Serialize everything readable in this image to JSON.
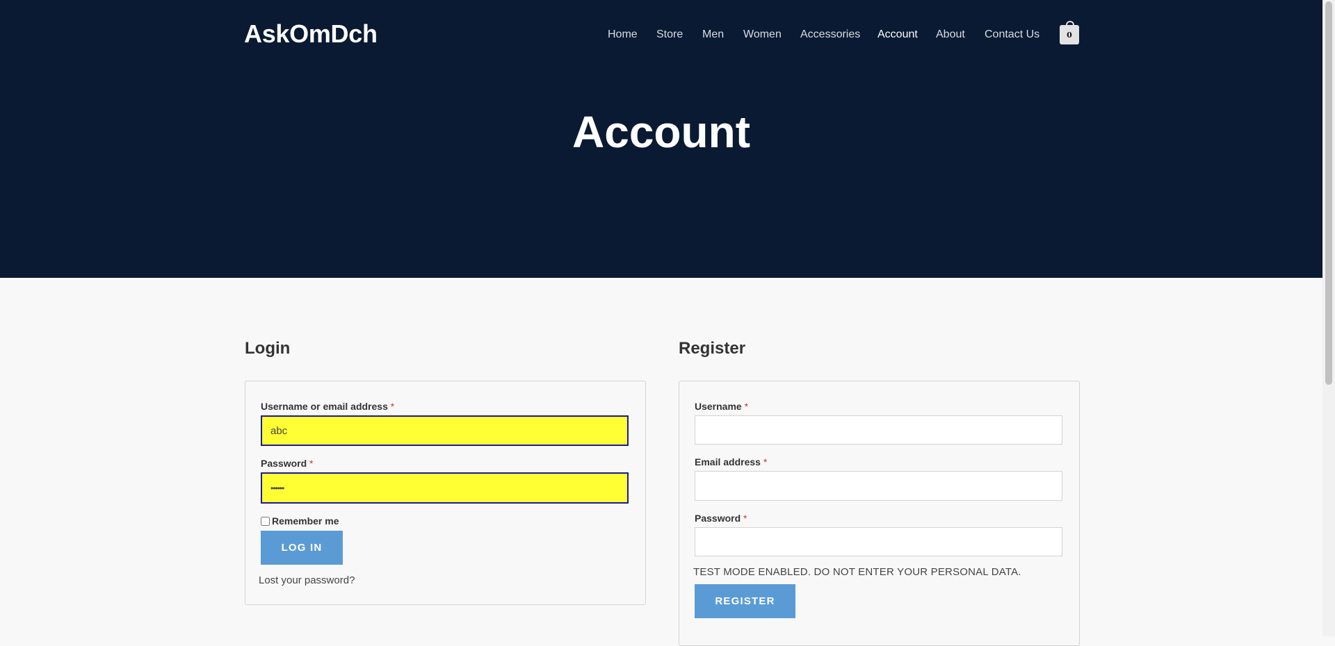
{
  "site": {
    "logo": "AskOmDch"
  },
  "nav": {
    "items": [
      {
        "label": "Home"
      },
      {
        "label": "Store"
      },
      {
        "label": "Men"
      },
      {
        "label": "Women"
      },
      {
        "label": "Accessories"
      },
      {
        "label": "Account",
        "active": true
      },
      {
        "label": "About"
      },
      {
        "label": "Contact Us"
      }
    ],
    "cart_count": "0"
  },
  "page": {
    "title": "Account"
  },
  "login": {
    "heading": "Login",
    "username_label": "Username or email address",
    "username_value": "abc",
    "password_label": "Password",
    "password_value": "••••••",
    "remember_label": "Remember me",
    "submit_label": "LOG IN",
    "lost_password": "Lost your password?"
  },
  "register": {
    "heading": "Register",
    "username_label": "Username",
    "email_label": "Email address",
    "password_label": "Password",
    "notice": "TEST MODE ENABLED. DO NOT ENTER YOUR PERSONAL DATA.",
    "submit_label": "REGISTER"
  },
  "required_marker": "*",
  "colors": {
    "header_bg": "#0b1a33",
    "accent_button": "#5b9bd5",
    "autofill_bg": "#ffff33",
    "required": "#cc3333"
  }
}
